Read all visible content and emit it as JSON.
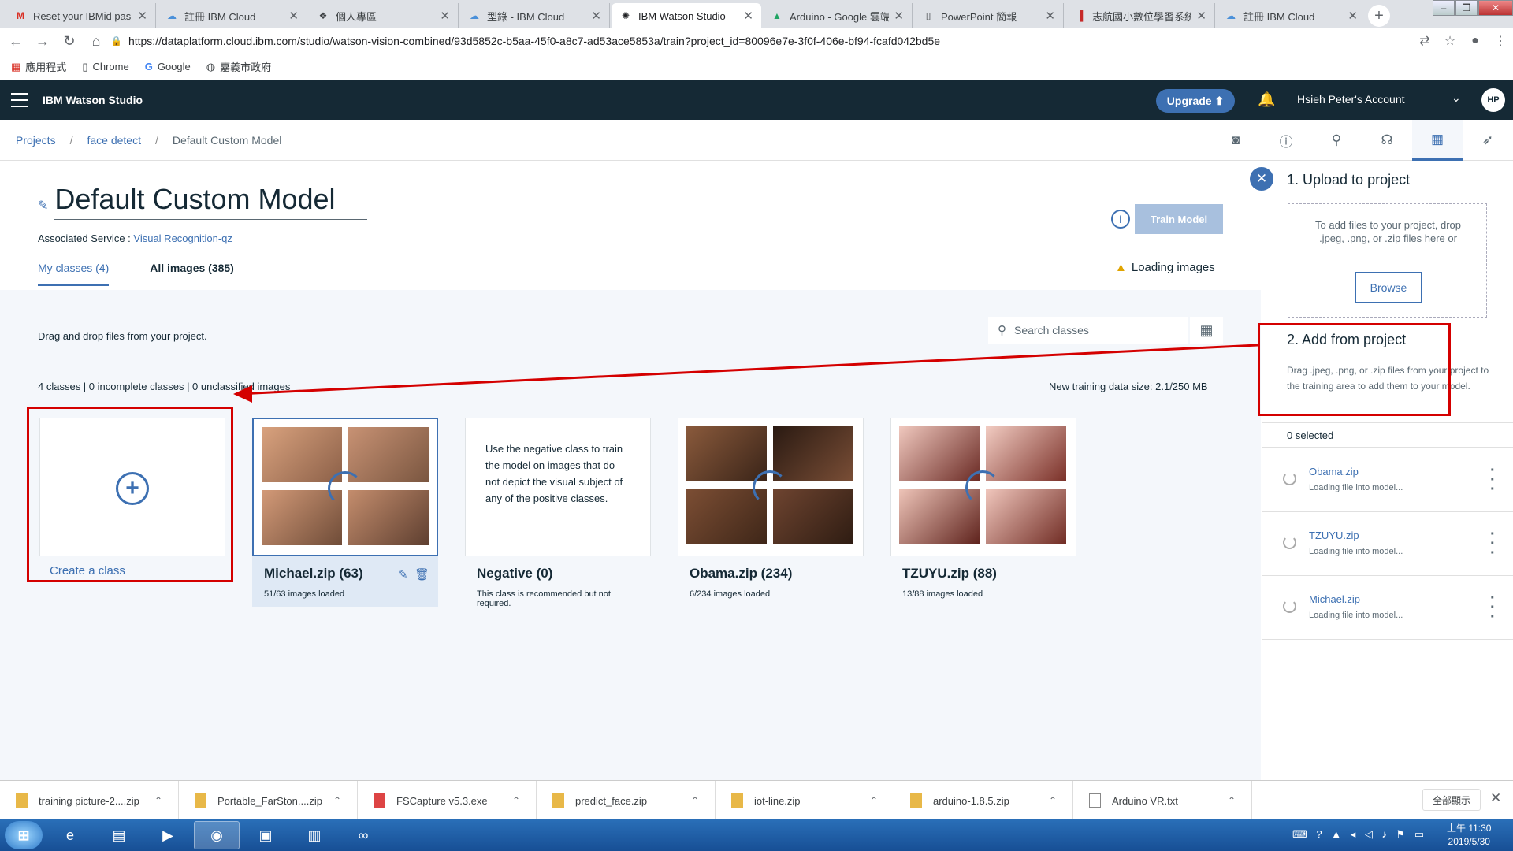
{
  "browser": {
    "tabs": [
      {
        "title": "Reset your IBMid pas",
        "icon": "gmail-icon",
        "color": "#d93025"
      },
      {
        "title": "註冊 IBM Cloud",
        "icon": "cloud-icon",
        "color": "#4a90d9"
      },
      {
        "title": "個人專區",
        "icon": "page-icon",
        "color": "#444"
      },
      {
        "title": "型錄 - IBM Cloud",
        "icon": "cloud-icon",
        "color": "#4a90d9"
      },
      {
        "title": "IBM Watson Studio",
        "icon": "watson-icon",
        "color": "#333"
      },
      {
        "title": "Arduino - Google 雲端",
        "icon": "drive-icon",
        "color": "#1fa463"
      },
      {
        "title": "PowerPoint 簡報",
        "icon": "doc-icon",
        "color": "#666"
      },
      {
        "title": "志航國小數位學習系統",
        "icon": "school-icon",
        "color": "#c62828"
      },
      {
        "title": "註冊 IBM Cloud",
        "icon": "cloud-icon",
        "color": "#4a90d9"
      }
    ],
    "url": "https://dataplatform.cloud.ibm.com/studio/watson-vision-combined/93d5852c-b5aa-45f0-a8c7-ad53ace5853a/train?project_id=80096e7e-3f0f-406e-bf94-fcafd042bd5e",
    "bookmarks": [
      "應用程式",
      "Chrome",
      "Google",
      "嘉義市政府"
    ]
  },
  "header": {
    "brand": "IBM Watson Studio",
    "upgrade": "Upgrade",
    "account": "Hsieh Peter's Account",
    "avatar": "HP"
  },
  "breadcrumb": [
    "Projects",
    "face detect",
    "Default Custom Model"
  ],
  "main": {
    "title": "Default Custom Model",
    "assoc_label": "Associated Service : ",
    "assoc_link": "Visual Recognition-qz",
    "train": "Train Model",
    "loading": "Loading images",
    "tabs": [
      "My classes (4)",
      "All images (385)"
    ],
    "drag_hint": "Drag and drop files from your project.",
    "search_placeholder": "Search classes",
    "stats": "4 classes | 0 incomplete classes | 0 unclassified images",
    "training_size": "New training data size: 2.1/250 MB",
    "create_label": "Create a class",
    "classes": [
      {
        "name": "Michael.zip (63)",
        "sub": "51/63 images loaded"
      },
      {
        "name": "Negative (0)",
        "sub": "This class is recommended but not required.",
        "desc": "Use the negative class to train the model on images that do not depict the visual subject of any of the positive classes."
      },
      {
        "name": "Obama.zip (234)",
        "sub": "6/234 images loaded"
      },
      {
        "name": "TZUYU.zip (88)",
        "sub": "13/88 images loaded"
      }
    ]
  },
  "panel": {
    "upload_title": "1. Upload to project",
    "drop_text": "To add files to your project, drop .jpeg, .png, or .zip files here or",
    "browse": "Browse",
    "add_title": "2. Add from project",
    "add_text": "Drag .jpeg, .png, or .zip files from your project to the training area to add them to your model.",
    "selected": "0 selected",
    "files": [
      {
        "name": "Obama.zip",
        "status": "Loading file into model..."
      },
      {
        "name": "TZUYU.zip",
        "status": "Loading file into model..."
      },
      {
        "name": "Michael.zip",
        "status": "Loading file into model..."
      }
    ]
  },
  "downloads": {
    "items": [
      "training picture-2....zip",
      "Portable_FarSton....zip",
      "FSCapture v5.3.exe",
      "predict_face.zip",
      "iot-line.zip",
      "arduino-1.8.5.zip",
      "Arduino VR.txt"
    ],
    "show_all": "全部顯示"
  },
  "taskbar": {
    "time": "上午 11:30",
    "date": "2019/5/30"
  }
}
